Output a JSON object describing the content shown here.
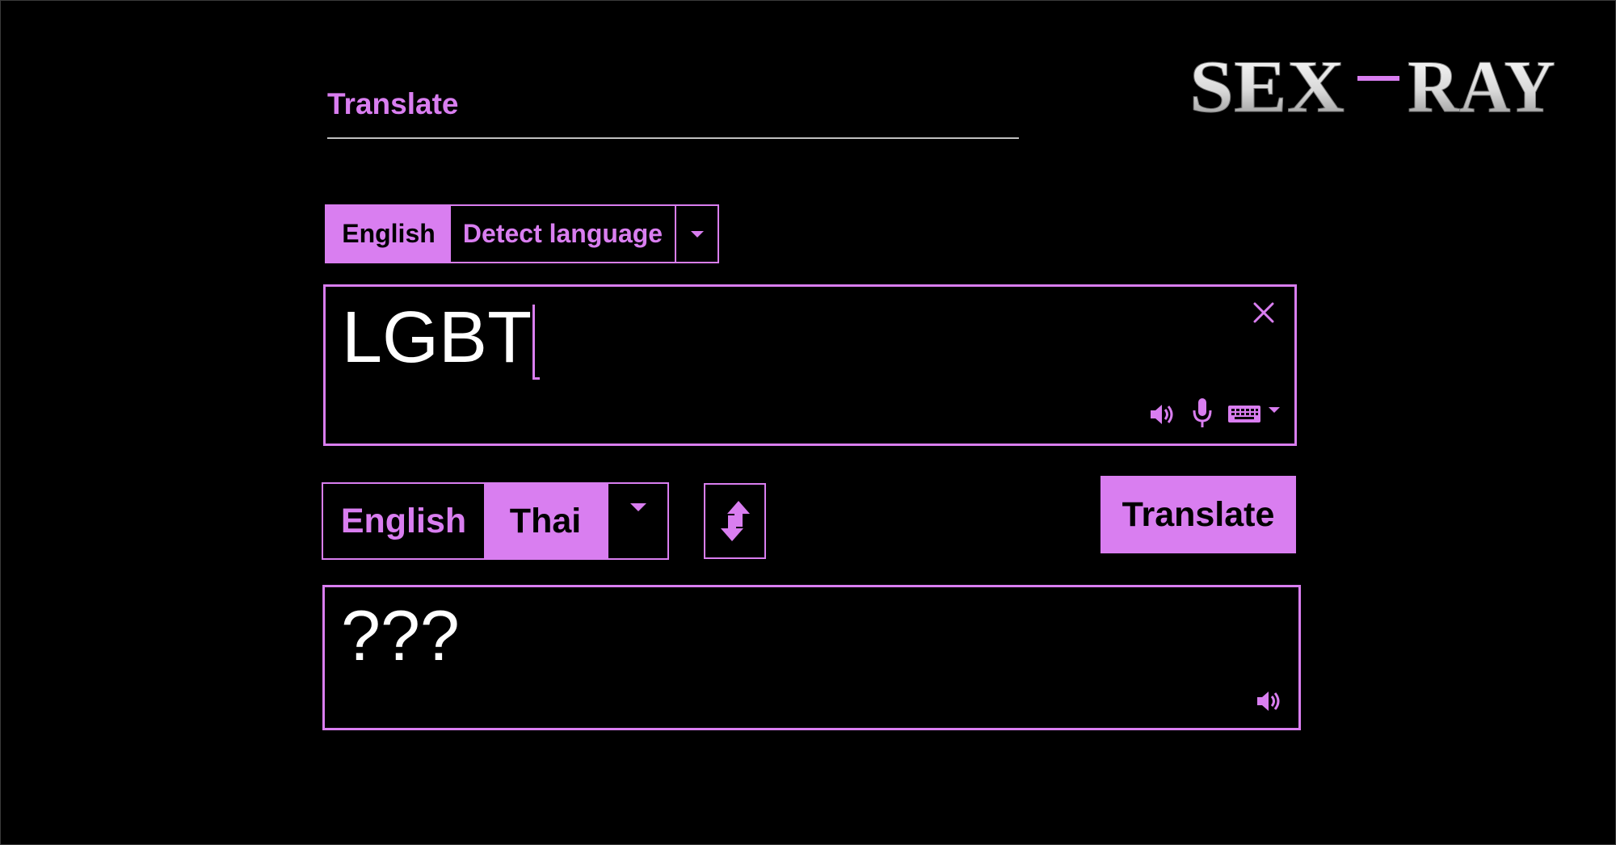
{
  "header": {
    "title": "Translate"
  },
  "logo": {
    "text_left": "SEX",
    "text_right": "RAY"
  },
  "source": {
    "languages": [
      "English",
      "Detect language"
    ],
    "selected": "English",
    "text": "LGBT"
  },
  "target": {
    "languages": [
      "English",
      "Thai"
    ],
    "selected": "Thai",
    "text": "???"
  },
  "actions": {
    "translate_label": "Translate"
  },
  "icons": {
    "clear": "close-icon",
    "speaker": "speaker-icon",
    "mic": "microphone-icon",
    "keyboard": "keyboard-icon",
    "dropdown": "chevron-down-icon",
    "swap": "swap-icon"
  },
  "colors": {
    "accent": "#d97ef0",
    "background": "#000000",
    "text": "#ffffff"
  }
}
